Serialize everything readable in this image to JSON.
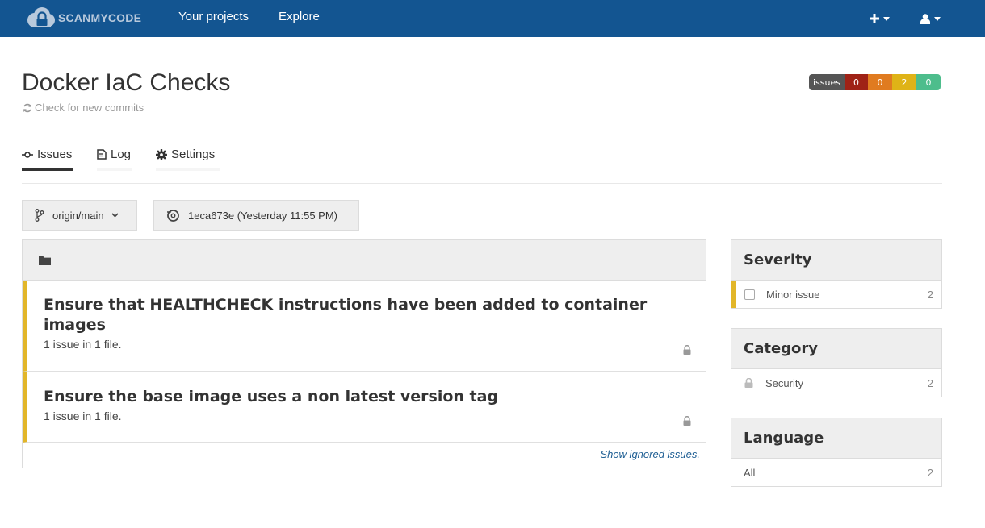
{
  "navbar": {
    "brand": "SCANMYCODE",
    "links": [
      "Your projects",
      "Explore"
    ],
    "colors": {
      "background": "#135591"
    }
  },
  "header": {
    "title": "Docker IaC Checks",
    "refresh_label": "Check for new commits"
  },
  "badge": {
    "label": "issues",
    "counts": [
      "0",
      "0",
      "2",
      "0"
    ],
    "colors": [
      "#9f2216",
      "#e07b20",
      "#dfb317",
      "#4dbd8c"
    ]
  },
  "tabs": [
    {
      "label": "Issues",
      "icon": "commit-icon",
      "active": true
    },
    {
      "label": "Log",
      "icon": "log-icon",
      "active": false
    },
    {
      "label": "Settings",
      "icon": "gear-icon",
      "active": false
    }
  ],
  "branch": {
    "label": "origin/main"
  },
  "commit": {
    "label": "1eca673e (Yesterday 11:55 PM)"
  },
  "issues": {
    "items": [
      {
        "title": "Ensure that HEALTHCHECK instructions have been added to container images",
        "summary": "1 issue in 1 file."
      },
      {
        "title": "Ensure the base image uses a non latest version tag",
        "summary": "1 issue in 1 file."
      }
    ],
    "show_ignored": "Show ignored issues."
  },
  "filters": {
    "severity": {
      "title": "Severity",
      "label": "Minor issue",
      "count": "2"
    },
    "category": {
      "title": "Category",
      "label": "Security",
      "count": "2"
    },
    "language": {
      "title": "Language",
      "label": "All",
      "count": "2"
    }
  }
}
